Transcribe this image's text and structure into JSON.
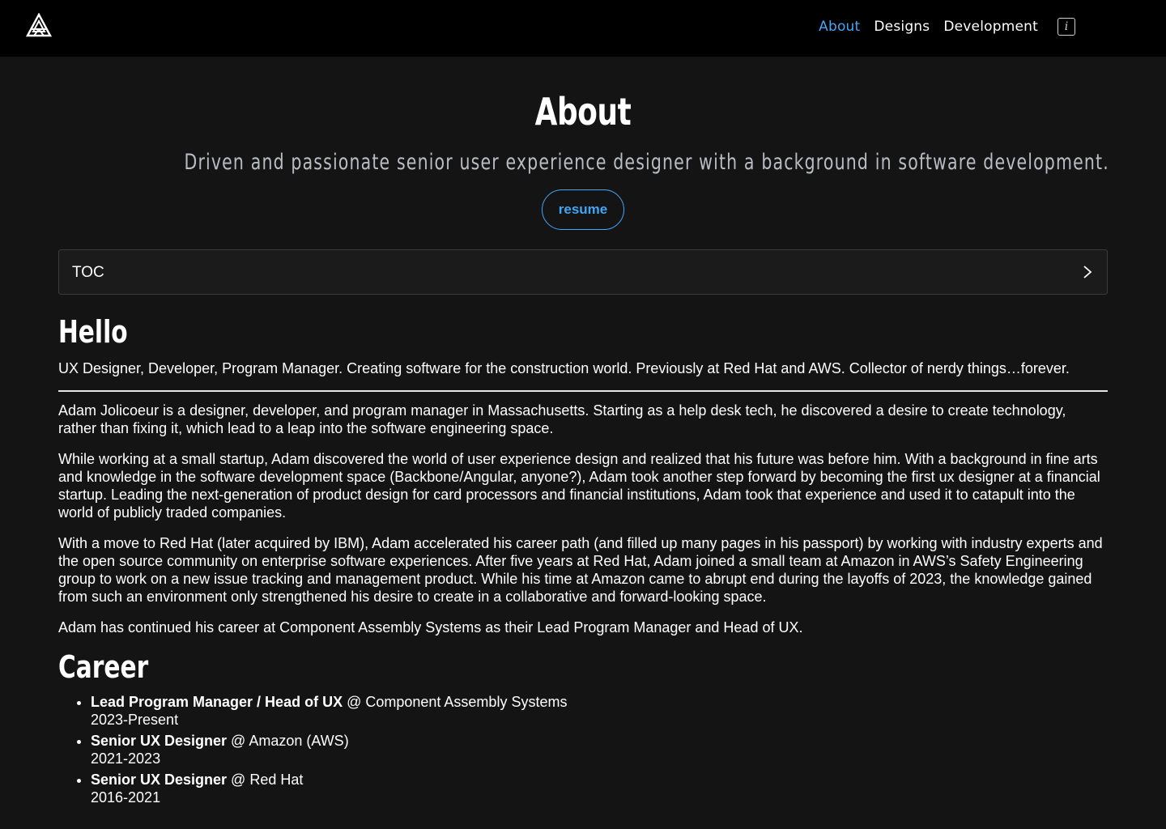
{
  "nav": {
    "items": [
      {
        "label": "About",
        "active": true
      },
      {
        "label": "Designs",
        "active": false
      },
      {
        "label": "Development",
        "active": false
      }
    ],
    "info_icon": "info-icon",
    "info_glyph": "i",
    "logo_icon": "logo-mark-icon"
  },
  "colors": {
    "accent": "#42a5f5",
    "background": "#141414",
    "topbar": "#000000"
  },
  "header": {
    "title": "About",
    "subtitle": "Driven and passionate senior user experience designer with a background in software development.",
    "resume_label": "resume"
  },
  "toc": {
    "label": "TOC",
    "icon": "chevron-right-icon"
  },
  "hello": {
    "heading": "Hello",
    "intro": "UX Designer, Developer, Program Manager. Creating software for the construction world. Previously at Red Hat and AWS. Collector of nerdy things…forever.",
    "paragraphs": [
      "Adam Jolicoeur is a designer, developer, and program manager in Massachusetts. Starting as a help desk tech, he discovered a desire to create technology, rather than fixing it, which lead to a leap into the software engineering space.",
      "While working at a small startup, Adam discovered the world of user experience design and realized that his future was before him. With a background in fine arts and knowledge in the software development space (Backbone/Angular, anyone?), Adam took another step forward by becoming the first ux designer at a financial startup. Leading the next-generation of product design for card processors and financial institutions, Adam took that experience and used it to catapult into the world of publicly traded companies.",
      "With a move to Red Hat (later acquired by IBM), Adam accelerated his career path (and filled up many pages in his passport) by working with industry experts and the open source community on enterprise software experiences. After five years at Red Hat, Adam joined a small team at Amazon in AWS’s Safety Engineering group to work on a new issue tracking and management product. While his time at Amazon came to abrupt end during the layoffs of 2023, the knowledge gained from such an environment only strengthened his desire to create in a collaborative and forward-looking space.",
      "Adam has continued his career at Component Assembly Systems as their Lead Program Manager and Head of UX."
    ]
  },
  "career": {
    "heading": "Career",
    "items": [
      {
        "role": "Lead Program Manager / Head of UX",
        "company": " @ Component Assembly Systems",
        "years": "2023-Present"
      },
      {
        "role": "Senior UX Designer",
        "company": " @ Amazon (AWS)",
        "years": "2021-2023"
      },
      {
        "role": "Senior UX Designer",
        "company": " @ Red Hat",
        "years": "2016-2021"
      }
    ]
  }
}
